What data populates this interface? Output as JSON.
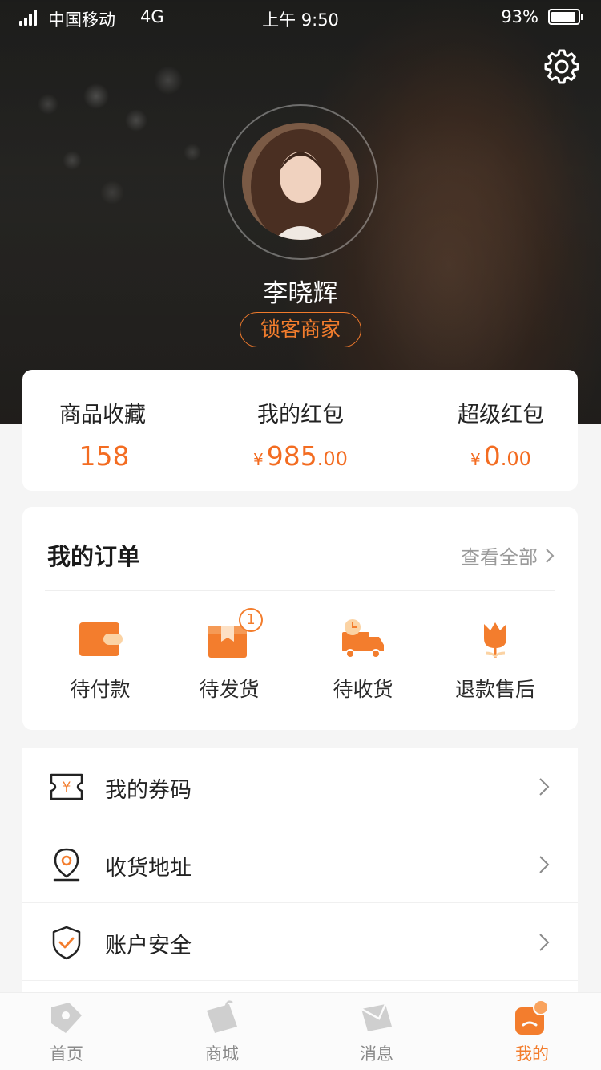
{
  "status_bar": {
    "carrier": "中国移动",
    "network": "4G",
    "time": "上午 9:50",
    "battery": "93%",
    "battery_level": 0.93
  },
  "profile": {
    "name": "李晓辉",
    "tag": "锁客商家"
  },
  "stats": [
    {
      "label": "商品收藏",
      "value": "158",
      "currency": "",
      "decimals": ""
    },
    {
      "label": "我的红包",
      "value": "985",
      "currency": "¥",
      "decimals": ".00"
    },
    {
      "label": "超级红包",
      "value": "0",
      "currency": "¥",
      "decimals": ".00"
    }
  ],
  "orders": {
    "title": "我的订单",
    "view_all": "查看全部",
    "items": [
      {
        "label": "待付款",
        "icon": "wallet-icon"
      },
      {
        "label": "待发货",
        "icon": "box-icon",
        "badge": "1"
      },
      {
        "label": "待收货",
        "icon": "delivery-truck-icon"
      },
      {
        "label": "退款售后",
        "icon": "tulip-icon"
      }
    ]
  },
  "menu": [
    {
      "label": "我的券码",
      "icon": "coupon-icon"
    },
    {
      "label": "收货地址",
      "icon": "location-pin-icon"
    },
    {
      "label": "账户安全",
      "icon": "shield-check-icon"
    }
  ],
  "tabs": [
    {
      "label": "首页",
      "icon": "home-tag-icon",
      "active": false
    },
    {
      "label": "商城",
      "icon": "shopping-bag-icon",
      "active": false
    },
    {
      "label": "消息",
      "icon": "envelope-icon",
      "active": false
    },
    {
      "label": "我的",
      "icon": "user-icon",
      "active": true
    }
  ],
  "colors": {
    "accent": "#f37d2d",
    "price": "#f36c21",
    "tab_inactive": "#cfcfcf"
  }
}
